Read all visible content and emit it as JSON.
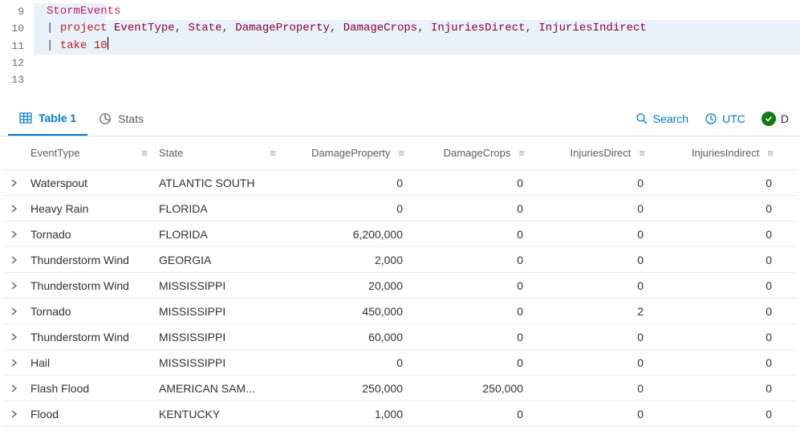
{
  "editor": {
    "lines": [
      {
        "n": "9",
        "html": "<span class='tk-ident'>StormEvents</span>"
      },
      {
        "n": "10",
        "html": "<span class='tk-op'>| </span><span class='tk-kw'>project</span><span class='tk-op'> </span><span class='tk-col'>EventType</span><span class='tk-op'>, </span><span class='tk-col'>State</span><span class='tk-op'>, </span><span class='tk-col'>DamageProperty</span><span class='tk-op'>, </span><span class='tk-col'>DamageCrops</span><span class='tk-op'>, </span><span class='tk-col'>InjuriesDirect</span><span class='tk-op'>, </span><span class='tk-col'>InjuriesIndirect</span>"
      },
      {
        "n": "11",
        "html": "<span class='tk-op'>| </span><span class='tk-kw'>take</span><span class='tk-op'> </span><span class='tk-num'>10</span><span class='cursor'></span>"
      },
      {
        "n": "12",
        "html": ""
      },
      {
        "n": "13",
        "html": ""
      }
    ]
  },
  "tabs": {
    "table_label": "Table 1",
    "stats_label": "Stats",
    "search_label": "Search",
    "tz_label": "UTC",
    "status_label": "D"
  },
  "table": {
    "columns": [
      {
        "key": "EventType",
        "cls": "col-event",
        "numeric": false
      },
      {
        "key": "State",
        "cls": "col-state",
        "numeric": false
      },
      {
        "key": "DamageProperty",
        "cls": "col-damprop",
        "numeric": true
      },
      {
        "key": "DamageCrops",
        "cls": "col-damcrop",
        "numeric": true
      },
      {
        "key": "InjuriesDirect",
        "cls": "col-injdir",
        "numeric": true
      },
      {
        "key": "InjuriesIndirect",
        "cls": "col-injind",
        "numeric": true
      }
    ],
    "rows": [
      {
        "EventType": "Waterspout",
        "State": "ATLANTIC SOUTH",
        "DamageProperty": "0",
        "DamageCrops": "0",
        "InjuriesDirect": "0",
        "InjuriesIndirect": "0"
      },
      {
        "EventType": "Heavy Rain",
        "State": "FLORIDA",
        "DamageProperty": "0",
        "DamageCrops": "0",
        "InjuriesDirect": "0",
        "InjuriesIndirect": "0"
      },
      {
        "EventType": "Tornado",
        "State": "FLORIDA",
        "DamageProperty": "6,200,000",
        "DamageCrops": "0",
        "InjuriesDirect": "0",
        "InjuriesIndirect": "0"
      },
      {
        "EventType": "Thunderstorm Wind",
        "State": "GEORGIA",
        "DamageProperty": "2,000",
        "DamageCrops": "0",
        "InjuriesDirect": "0",
        "InjuriesIndirect": "0"
      },
      {
        "EventType": "Thunderstorm Wind",
        "State": "MISSISSIPPI",
        "DamageProperty": "20,000",
        "DamageCrops": "0",
        "InjuriesDirect": "0",
        "InjuriesIndirect": "0"
      },
      {
        "EventType": "Tornado",
        "State": "MISSISSIPPI",
        "DamageProperty": "450,000",
        "DamageCrops": "0",
        "InjuriesDirect": "2",
        "InjuriesIndirect": "0"
      },
      {
        "EventType": "Thunderstorm Wind",
        "State": "MISSISSIPPI",
        "DamageProperty": "60,000",
        "DamageCrops": "0",
        "InjuriesDirect": "0",
        "InjuriesIndirect": "0"
      },
      {
        "EventType": "Hail",
        "State": "MISSISSIPPI",
        "DamageProperty": "0",
        "DamageCrops": "0",
        "InjuriesDirect": "0",
        "InjuriesIndirect": "0"
      },
      {
        "EventType": "Flash Flood",
        "State": "AMERICAN SAM...",
        "DamageProperty": "250,000",
        "DamageCrops": "250,000",
        "InjuriesDirect": "0",
        "InjuriesIndirect": "0"
      },
      {
        "EventType": "Flood",
        "State": "KENTUCKY",
        "DamageProperty": "1,000",
        "DamageCrops": "0",
        "InjuriesDirect": "0",
        "InjuriesIndirect": "0"
      }
    ]
  }
}
